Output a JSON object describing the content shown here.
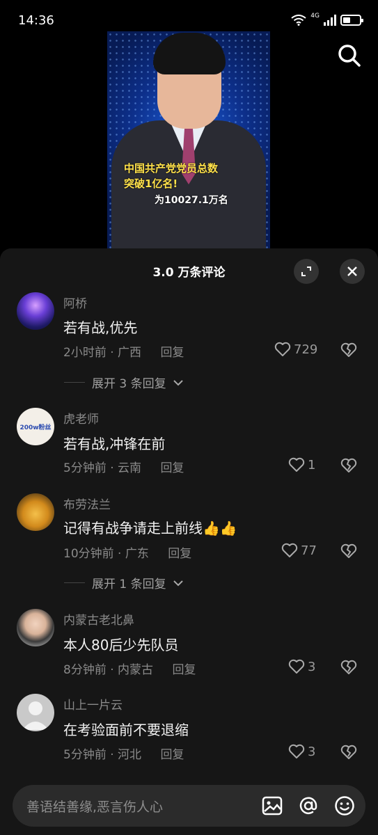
{
  "status": {
    "time": "14:36",
    "network": "4G"
  },
  "video": {
    "headline_1": "中国共产党党员总数",
    "headline_2": "突破1亿名!",
    "subline": "为10027.1万名"
  },
  "comments_panel": {
    "title": "3.0 万条评论",
    "comments": [
      {
        "user": "阿桥",
        "text": "若有战,优先",
        "time": "2小时前 · 广西",
        "reply": "回复",
        "likes": "729",
        "expand": "展开 3 条回复"
      },
      {
        "user": "虎老师",
        "avatar_label": "200w粉丝",
        "text": "若有战,冲锋在前",
        "time": "5分钟前 · 云南",
        "reply": "回复",
        "likes": "1"
      },
      {
        "user": "布劳法兰",
        "text": "记得有战争请走上前线👍👍",
        "time": "10分钟前 · 广东",
        "reply": "回复",
        "likes": "77",
        "expand": "展开 1 条回复"
      },
      {
        "user": "内蒙古老北鼻",
        "text": "本人80后少先队员",
        "time": "8分钟前 · 内蒙古",
        "reply": "回复",
        "likes": "3"
      },
      {
        "user": "山上一片云",
        "text": "在考验面前不要退缩",
        "time": "5分钟前 · 河北",
        "reply": "回复",
        "likes": "3"
      }
    ]
  },
  "input": {
    "placeholder": "善语结善缘,恶言伤人心"
  },
  "icons": [
    "search-icon",
    "expand-icon",
    "close-icon",
    "heart-icon",
    "broken-heart-icon",
    "image-icon",
    "at-icon",
    "emoji-icon"
  ]
}
